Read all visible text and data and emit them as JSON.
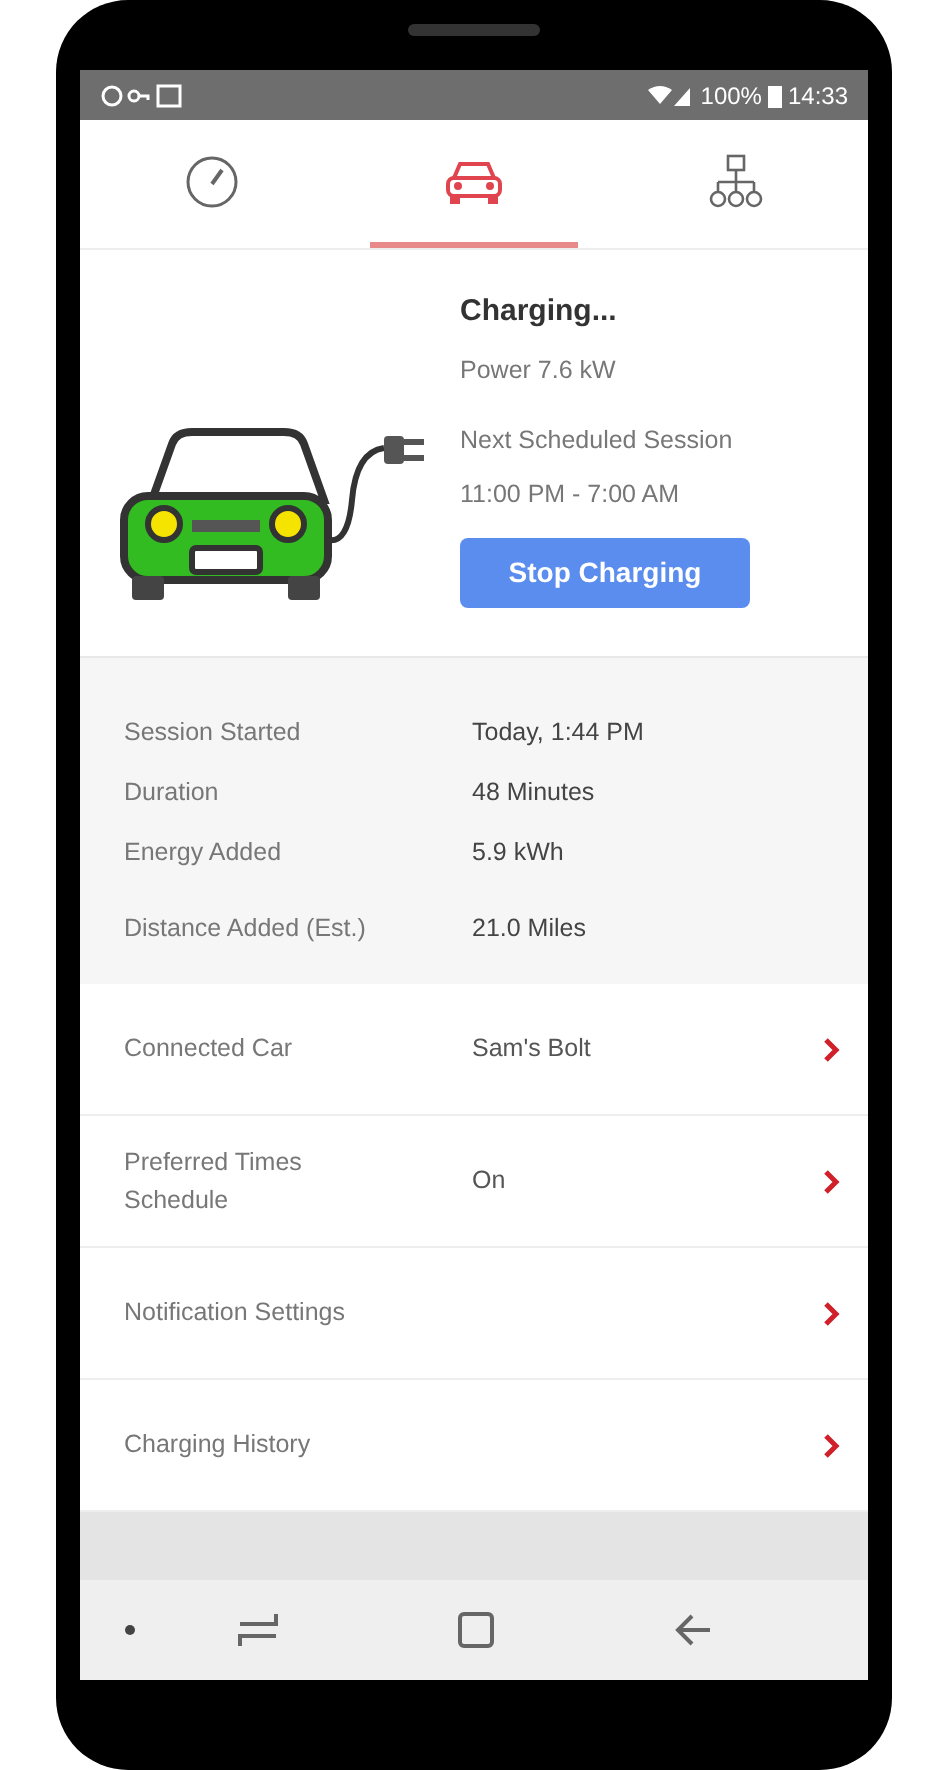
{
  "status_bar": {
    "battery": "100%",
    "time": "14:33"
  },
  "tabs": [
    {
      "kind": "gauge",
      "selected": false
    },
    {
      "kind": "car",
      "selected": true
    },
    {
      "kind": "network",
      "selected": false
    }
  ],
  "charging": {
    "status": "Charging...",
    "power": "Power 7.6 kW",
    "schedule_label": "Next Scheduled Session",
    "schedule_time": "11:00 PM - 7:00 AM",
    "button": "Stop Charging"
  },
  "session": [
    {
      "label": "Session Started",
      "value": "Today, 1:44 PM"
    },
    {
      "label": "Duration",
      "value": "48 Minutes"
    },
    {
      "label": "Energy Added",
      "value": "5.9 kWh"
    },
    {
      "label": "Distance Added (Est.)",
      "value": "21.0 Miles"
    }
  ],
  "settings": [
    {
      "label": "Connected Car",
      "value": "Sam's Bolt"
    },
    {
      "label": "Preferred Times Schedule",
      "value": "On"
    },
    {
      "label": "Notification Settings"
    },
    {
      "label": "Charging History"
    }
  ]
}
